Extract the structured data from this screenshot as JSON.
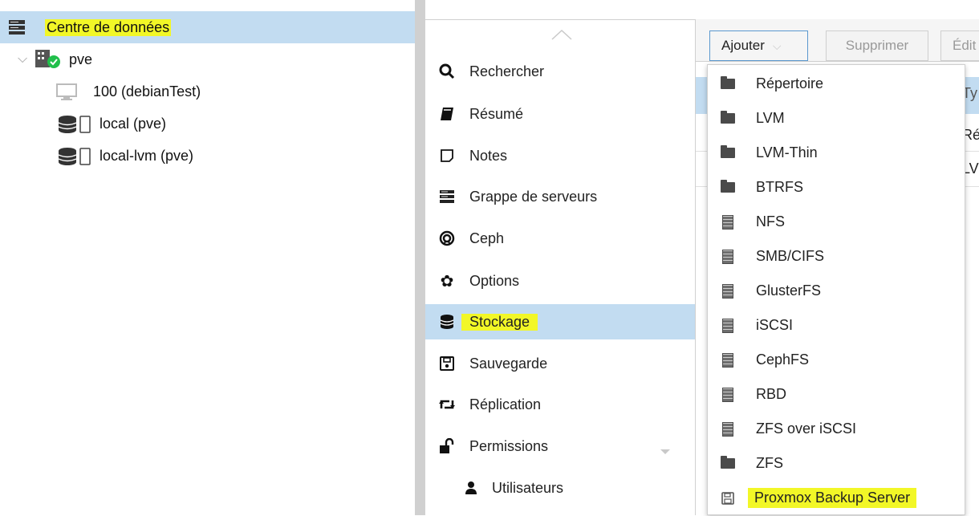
{
  "tree": {
    "root": "Centre de données",
    "node": "pve",
    "items": [
      "100 (debianTest)",
      "local (pve)",
      "local-lvm (pve)"
    ]
  },
  "nav": {
    "items": [
      {
        "label": "Rechercher",
        "icon": "search-icon"
      },
      {
        "label": "Résumé",
        "icon": "book-icon"
      },
      {
        "label": "Notes",
        "icon": "note-icon"
      },
      {
        "label": "Grappe de serveurs",
        "icon": "server-icon"
      },
      {
        "label": "Ceph",
        "icon": "ceph-icon"
      },
      {
        "label": "Options",
        "icon": "gear-icon"
      },
      {
        "label": "Stockage",
        "icon": "database-icon"
      },
      {
        "label": "Sauvegarde",
        "icon": "floppy-icon"
      },
      {
        "label": "Réplication",
        "icon": "retweet-icon"
      },
      {
        "label": "Permissions",
        "icon": "unlock-icon"
      },
      {
        "label": "Utilisateurs",
        "icon": "user-icon"
      }
    ],
    "selected": "Stockage"
  },
  "toolbar": {
    "add_label": "Ajouter",
    "delete_label": "Supprimer",
    "edit_label": "Édit"
  },
  "grid_partial": [
    "Ty",
    "Ré",
    "LV"
  ],
  "menu": {
    "items": [
      {
        "label": "Répertoire",
        "icon": "folder-icon"
      },
      {
        "label": "LVM",
        "icon": "folder-icon"
      },
      {
        "label": "LVM-Thin",
        "icon": "folder-icon"
      },
      {
        "label": "BTRFS",
        "icon": "folder-icon"
      },
      {
        "label": "NFS",
        "icon": "building-icon"
      },
      {
        "label": "SMB/CIFS",
        "icon": "building-icon"
      },
      {
        "label": "GlusterFS",
        "icon": "building-icon"
      },
      {
        "label": "iSCSI",
        "icon": "building-icon"
      },
      {
        "label": "CephFS",
        "icon": "building-icon"
      },
      {
        "label": "RBD",
        "icon": "building-icon"
      },
      {
        "label": "ZFS over iSCSI",
        "icon": "building-icon"
      },
      {
        "label": "ZFS",
        "icon": "folder-icon"
      },
      {
        "label": "Proxmox Backup Server",
        "icon": "floppy-icon"
      }
    ]
  },
  "colors": {
    "selection": "#c2dcf1",
    "highlight": "#f2f727",
    "status_ok": "#21bf4b"
  }
}
